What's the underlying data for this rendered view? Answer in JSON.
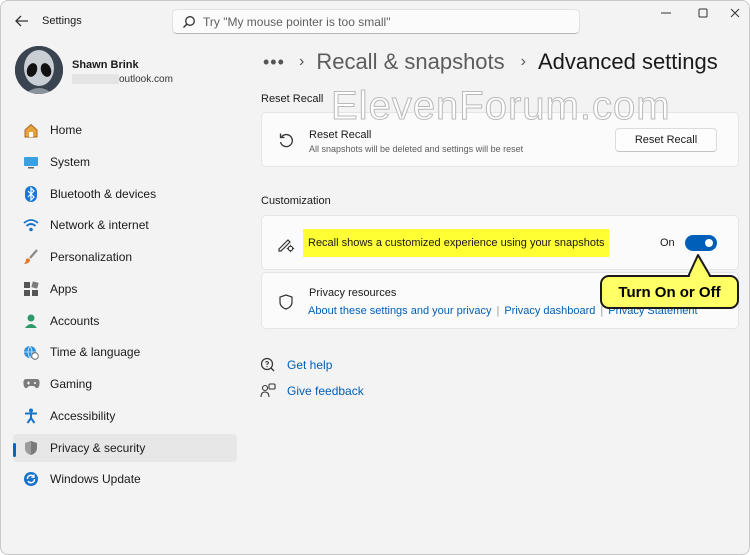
{
  "titlebar": {
    "app_title": "Settings",
    "search_placeholder": "Try \"My mouse pointer is too small\"",
    "icons": [
      "back-arrow-icon",
      "search-icon",
      "minimize-icon",
      "maximize-icon",
      "close-icon"
    ]
  },
  "profile": {
    "name": "Shawn Brink",
    "email_visible": "outlook.com"
  },
  "sidebar": {
    "items": [
      {
        "label": "Home",
        "icon": "home-icon"
      },
      {
        "label": "System",
        "icon": "monitor-icon"
      },
      {
        "label": "Bluetooth & devices",
        "icon": "bluetooth-icon"
      },
      {
        "label": "Network & internet",
        "icon": "wifi-icon"
      },
      {
        "label": "Personalization",
        "icon": "paintbrush-icon"
      },
      {
        "label": "Apps",
        "icon": "apps-icon"
      },
      {
        "label": "Accounts",
        "icon": "person-icon"
      },
      {
        "label": "Time & language",
        "icon": "globe-clock-icon"
      },
      {
        "label": "Gaming",
        "icon": "gamepad-icon"
      },
      {
        "label": "Accessibility",
        "icon": "accessibility-icon"
      },
      {
        "label": "Privacy & security",
        "icon": "shield-icon"
      },
      {
        "label": "Windows Update",
        "icon": "update-icon"
      }
    ],
    "active": "Privacy & security"
  },
  "breadcrumb": {
    "more": "•••",
    "sep": "›",
    "parent": "Recall & snapshots",
    "current": "Advanced settings"
  },
  "watermark": "ElevenForum.com",
  "reset_section": {
    "heading": "Reset Recall",
    "title": "Reset Recall",
    "subtitle": "All snapshots will be deleted and settings will be reset",
    "button": "Reset Recall"
  },
  "customization": {
    "heading": "Customization",
    "toggle_text": "Recall shows a customized experience using your snapshots",
    "toggle_state": "On",
    "toggle_on": true
  },
  "privacy": {
    "title": "Privacy resources",
    "links": [
      "About these settings and your privacy",
      "Privacy dashboard",
      "Privacy Statement"
    ]
  },
  "help": {
    "get_help": "Get help",
    "give_feedback": "Give feedback"
  },
  "callout": "Turn On or Off",
  "colors": {
    "accent": "#005fb8",
    "highlight": "#ffff33",
    "callout": "#ffff66"
  }
}
